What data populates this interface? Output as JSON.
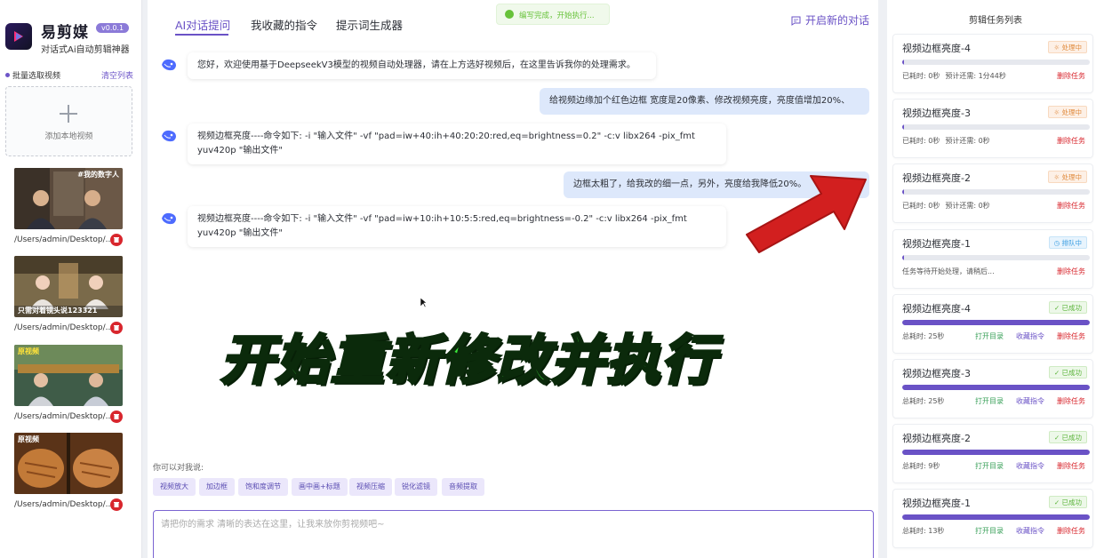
{
  "app": {
    "name": "易剪媒",
    "version": "v0.0.1",
    "tagline": "对话式Ai自动剪辑神器"
  },
  "sidebar": {
    "batch_label": "批量选取视频",
    "clear_label": "清空列表",
    "add_label": "添加本地视频",
    "videos": [
      {
        "path": "/Users/admin/Desktop/...",
        "caption": "#我的数字人"
      },
      {
        "path": "/Users/admin/Desktop/...",
        "caption": "只需对着镜头说123321"
      },
      {
        "path": "/Users/admin/Desktop/...",
        "caption": "原视频"
      },
      {
        "path": "/Users/admin/Desktop/...",
        "caption": "原视频"
      }
    ]
  },
  "tabs": [
    {
      "label": "AI对话提问",
      "active": true
    },
    {
      "label": "我收藏的指令",
      "active": false
    },
    {
      "label": "提示词生成器",
      "active": false
    }
  ],
  "new_chat_label": "开启新的对话",
  "toast": "编写完成，开始执行...",
  "chat": [
    {
      "role": "bot",
      "text": "您好，欢迎使用基于DeepseekV3模型的视频自动处理器，请在上方选好视频后，在这里告诉我你的处理需求。"
    },
    {
      "role": "user",
      "text": "给视频边缘加个红色边框 宽度是20像素、修改视频亮度，亮度值增加20%、"
    },
    {
      "role": "bot",
      "text": "视频边框亮度----命令如下: -i \"输入文件\" -vf \"pad=iw+40:ih+40:20:20:red,eq=brightness=0.2\" -c:v libx264 -pix_fmt yuv420p \"输出文件\""
    },
    {
      "role": "user",
      "text": "边框太粗了，给我改的细一点，另外，亮度给我降低20%。"
    },
    {
      "role": "bot",
      "text": "视频边框亮度----命令如下: -i \"输入文件\" -vf \"pad=iw+10:ih+10:5:5:red,eq=brightness=-0.2\" -c:v libx264 -pix_fmt yuv420p \"输出文件\""
    }
  ],
  "overlay_caption": "开始重新修改并执行",
  "suggestions": {
    "label": "你可以对我说:",
    "chips": [
      "视频放大",
      "加边框",
      "饱和度调节",
      "画中画+标题",
      "视频压缩",
      "锐化滤镜",
      "音频提取"
    ]
  },
  "input": {
    "placeholder": "请把你的需求 清晰的表达在这里，让我来放你剪视频吧~"
  },
  "tasks": {
    "title": "剪辑任务列表",
    "items": [
      {
        "name": "视频边框亮度-4",
        "status": "处理中",
        "kind": "processing",
        "progress": 0.0,
        "elapsed": "已耗时: 0秒",
        "eta": "预计还需: 1分44秒",
        "actions": [
          "删除任务"
        ]
      },
      {
        "name": "视频边框亮度-3",
        "status": "处理中",
        "kind": "processing",
        "progress": 0.0,
        "elapsed": "已耗时: 0秒",
        "eta": "预计还需: 0秒",
        "actions": [
          "删除任务"
        ]
      },
      {
        "name": "视频边框亮度-2",
        "status": "处理中",
        "kind": "processing",
        "progress": 0.0,
        "elapsed": "已耗时: 0秒",
        "eta": "预计还需: 0秒",
        "actions": [
          "删除任务"
        ]
      },
      {
        "name": "视频边框亮度-1",
        "status": "排队中",
        "kind": "queued",
        "progress": 0.0,
        "elapsed": "任务等待开始处理，请稍后...",
        "eta": "",
        "actions": [
          "删除任务"
        ]
      },
      {
        "name": "视频边框亮度-4",
        "status": "已成功",
        "kind": "success",
        "progress": 1.0,
        "elapsed": "总耗时: 25秒",
        "eta": "",
        "actions": [
          "打开目录",
          "收藏指令",
          "删除任务"
        ]
      },
      {
        "name": "视频边框亮度-3",
        "status": "已成功",
        "kind": "success",
        "progress": 1.0,
        "elapsed": "总耗时: 25秒",
        "eta": "",
        "actions": [
          "打开目录",
          "收藏指令",
          "删除任务"
        ]
      },
      {
        "name": "视频边框亮度-2",
        "status": "已成功",
        "kind": "success",
        "progress": 1.0,
        "elapsed": "总耗时: 9秒",
        "eta": "",
        "actions": [
          "打开目录",
          "收藏指令",
          "删除任务"
        ]
      },
      {
        "name": "视频边框亮度-1",
        "status": "已成功",
        "kind": "success",
        "progress": 1.0,
        "elapsed": "总耗时: 13秒",
        "eta": "",
        "actions": [
          "打开目录",
          "收藏指令",
          "删除任务"
        ]
      }
    ]
  },
  "colors": {
    "accent": "#6a52c6",
    "danger": "#d8262d",
    "success": "#5bb43a",
    "warning": "#e08a3c",
    "overlay": "#39e639",
    "arrow": "#d21f1f"
  }
}
